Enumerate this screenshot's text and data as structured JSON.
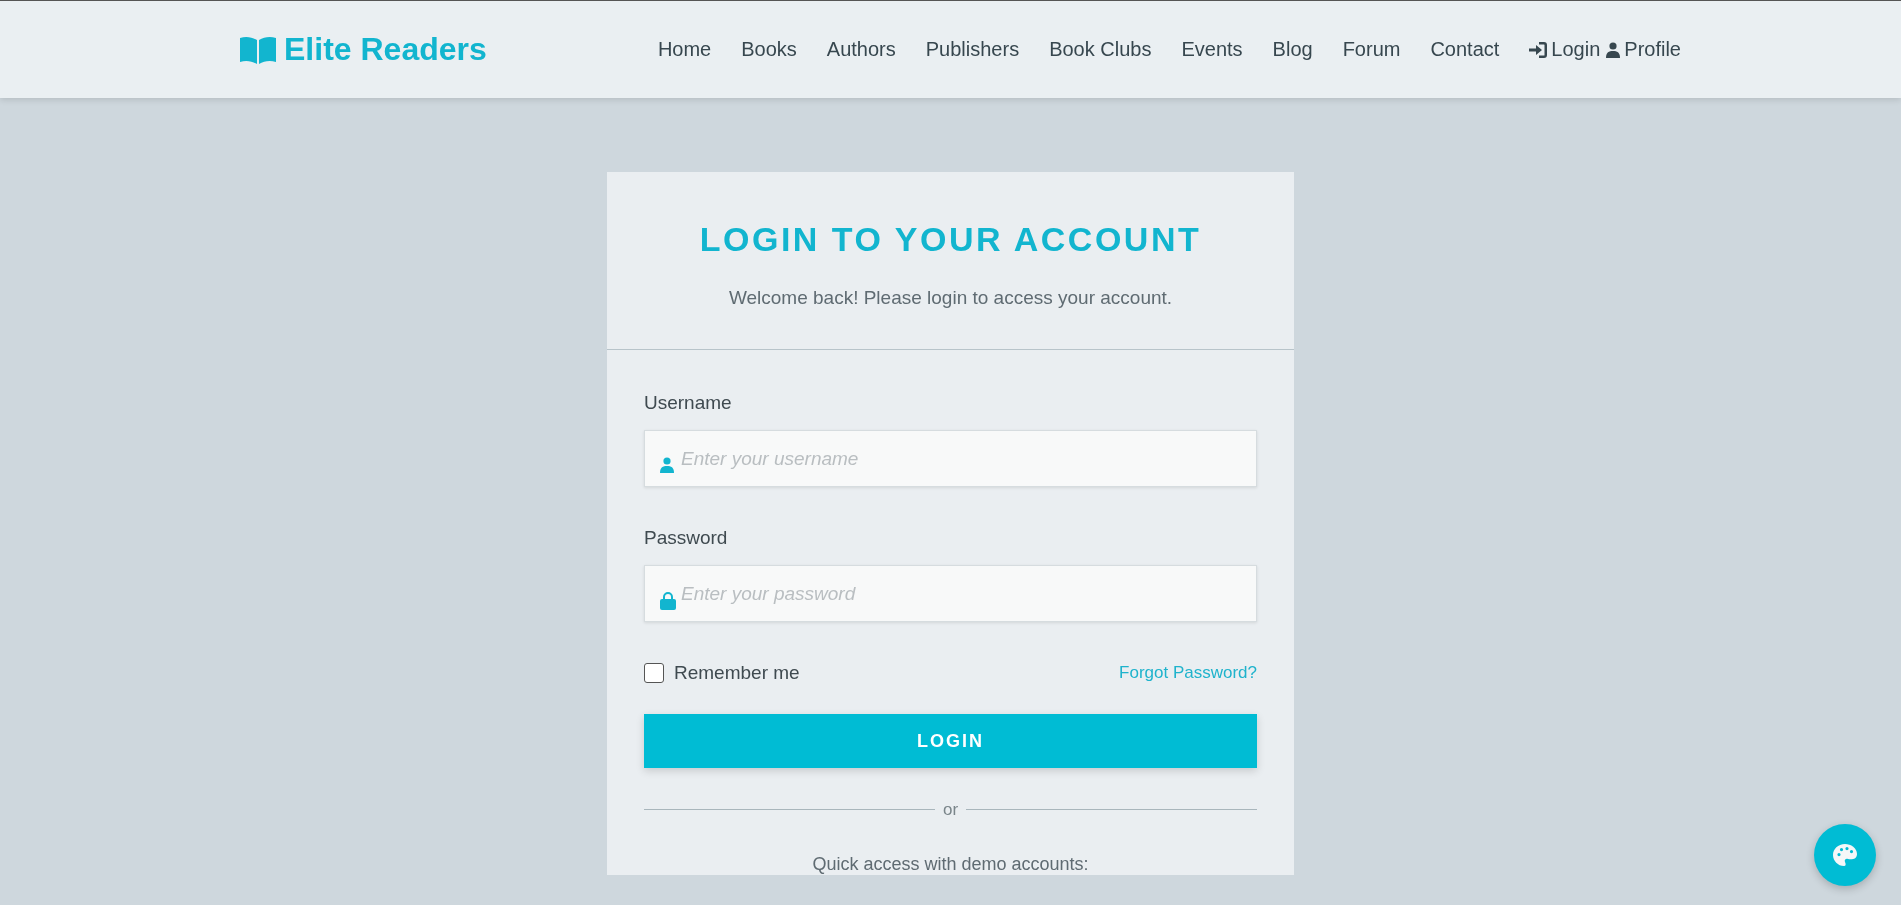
{
  "brand": {
    "name": "Elite Readers"
  },
  "nav": [
    {
      "label": "Home",
      "kind": "link"
    },
    {
      "label": "Books",
      "kind": "link"
    },
    {
      "label": "Authors",
      "kind": "link"
    },
    {
      "label": "Publishers",
      "kind": "link"
    },
    {
      "label": "Book Clubs",
      "kind": "link"
    },
    {
      "label": "Events",
      "kind": "link"
    },
    {
      "label": "Blog",
      "kind": "link"
    },
    {
      "label": "Forum",
      "kind": "link"
    },
    {
      "label": "Contact",
      "kind": "link"
    },
    {
      "label": "Login",
      "kind": "login"
    },
    {
      "label": "Profile",
      "kind": "profile"
    }
  ],
  "login_card": {
    "title": "LOGIN TO YOUR ACCOUNT",
    "subtitle": "Welcome back! Please login to access your account.",
    "fields": [
      {
        "label": "Username",
        "placeholder": "Enter your username",
        "kind": "user"
      },
      {
        "label": "Password",
        "placeholder": "Enter your password",
        "kind": "password"
      }
    ],
    "remember": {
      "label": "Remember me",
      "checked": false
    },
    "forgot_link": "Forgot Password?",
    "submit": "LOGIN",
    "divider": "or",
    "quick_access": "Quick access with demo accounts:"
  }
}
